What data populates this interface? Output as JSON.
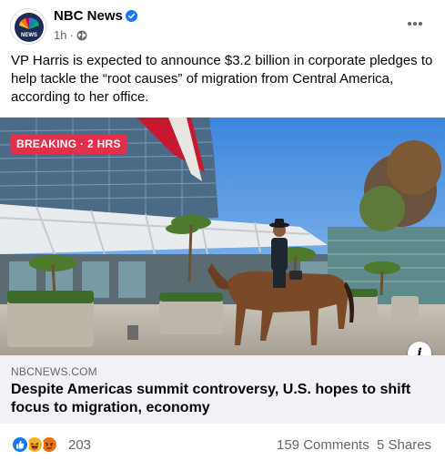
{
  "post": {
    "page_name": "NBC News",
    "timestamp": "1h",
    "separator": "·",
    "caption": "VP Harris is expected to announce $3.2 billion in corporate pledges to help tackle the “root causes” of migration from Central America, according to her office.",
    "avatar_label": "NEWS"
  },
  "media": {
    "badge": "BREAKING · 2 HRS",
    "info_glyph": "i"
  },
  "link": {
    "domain": "NBCNEWS.COM",
    "title": "Despite Americas summit controversy, U.S. hopes to shift focus to migration, economy"
  },
  "engagement": {
    "reaction_count": "203",
    "comments": "159 Comments",
    "shares": "5 Shares",
    "reactions": [
      "like-icon",
      "haha-icon",
      "angry-icon"
    ]
  },
  "colors": {
    "verified": "#1877f2",
    "breaking": "#e3304a",
    "like": "#1877f2",
    "haha": "#f7b125",
    "angry": "#e9710f",
    "muted_text": "#65676b",
    "link_box": "#f0f2f5"
  }
}
